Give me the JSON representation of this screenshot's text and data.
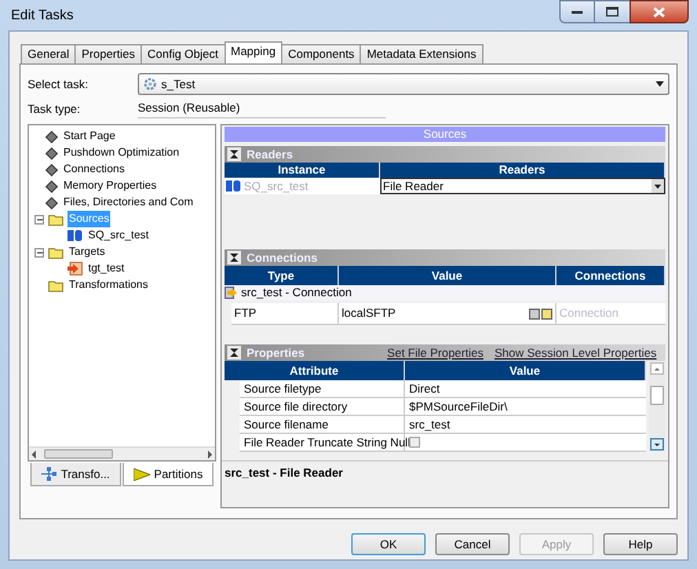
{
  "window": {
    "title": "Edit Tasks"
  },
  "tabs": [
    {
      "label": "General",
      "selected": false
    },
    {
      "label": "Properties",
      "selected": false
    },
    {
      "label": "Config Object",
      "selected": false
    },
    {
      "label": "Mapping",
      "selected": true
    },
    {
      "label": "Components",
      "selected": false
    },
    {
      "label": "Metadata Extensions",
      "selected": false
    }
  ],
  "select_task": {
    "label": "Select task:",
    "value": "s_Test"
  },
  "task_type": {
    "label": "Task type:",
    "value": "Session (Reusable)"
  },
  "tree": [
    {
      "label": "Start Page",
      "kind": "page",
      "selected": false
    },
    {
      "label": "Pushdown Optimization",
      "kind": "page",
      "selected": false
    },
    {
      "label": "Connections",
      "kind": "page",
      "selected": false
    },
    {
      "label": "Memory Properties",
      "kind": "page",
      "selected": false
    },
    {
      "label": "Files, Directories and Com",
      "kind": "page",
      "selected": false
    },
    {
      "label": "Sources",
      "kind": "folder",
      "selected": true,
      "expanded": true,
      "children": [
        {
          "label": "SQ_src_test",
          "kind": "qualifier",
          "selected": false
        }
      ]
    },
    {
      "label": "Targets",
      "kind": "folder",
      "selected": false,
      "expanded": true,
      "children": [
        {
          "label": "tgt_test",
          "kind": "target",
          "selected": false
        }
      ]
    },
    {
      "label": "Transformations",
      "kind": "folder",
      "selected": false
    }
  ],
  "left_tabs": [
    {
      "label": "Transfo...",
      "kind": "transformations",
      "selected": false
    },
    {
      "label": "Partitions",
      "kind": "partitions",
      "selected": true
    }
  ],
  "panel_title": "Sources",
  "readers": {
    "title": "Readers",
    "columns": [
      "Instance",
      "Readers"
    ],
    "rows": [
      {
        "instance": "SQ_src_test",
        "reader": "File Reader"
      }
    ]
  },
  "connections": {
    "title": "Connections",
    "columns": [
      "Type",
      "Value",
      "Connections"
    ],
    "group": "src_test - Connection",
    "rows": [
      {
        "type": "FTP",
        "value": "localSFTP",
        "placeholder": "Connection"
      }
    ]
  },
  "properties": {
    "title": "Properties",
    "links": [
      "Set File Properties",
      "Show Session Level Properties"
    ],
    "columns": [
      "Attribute",
      "Value"
    ],
    "rows": [
      {
        "attribute": "Source filetype",
        "kind": "text",
        "value": "Direct"
      },
      {
        "attribute": "Source file directory",
        "kind": "text",
        "value": "$PMSourceFileDir\\"
      },
      {
        "attribute": "Source filename",
        "kind": "text",
        "value": "src_test"
      },
      {
        "attribute": "File Reader Truncate String Null",
        "kind": "checkbox",
        "checked": false
      }
    ]
  },
  "description": "src_test - File Reader",
  "buttons": [
    {
      "label": "OK",
      "default": true,
      "disabled": false
    },
    {
      "label": "Cancel",
      "default": false,
      "disabled": false
    },
    {
      "label": "Apply",
      "default": false,
      "disabled": true
    },
    {
      "label": "Help",
      "default": false,
      "disabled": false
    }
  ]
}
